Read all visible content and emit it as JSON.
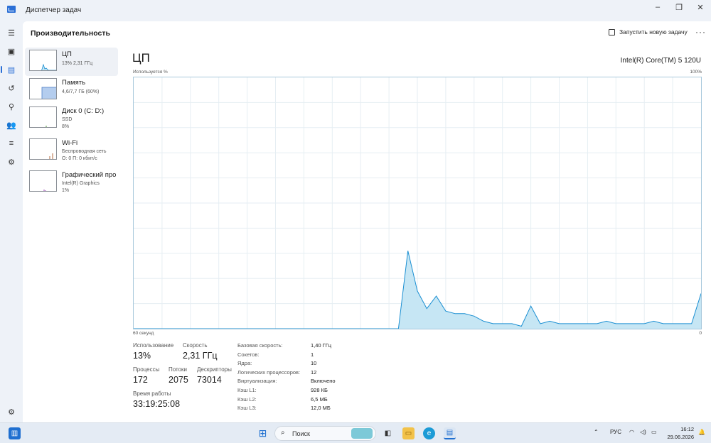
{
  "window": {
    "title": "Диспетчер задач"
  },
  "header": {
    "title": "Производительность",
    "new_task_label": "Запустить новую задачу"
  },
  "devices": [
    {
      "name": "ЦП",
      "sub1": "13% 2,31 ГГц",
      "sub2": "",
      "sub3": ""
    },
    {
      "name": "Память",
      "sub1": "4,6/7,7 ГБ (60%)",
      "sub2": "",
      "sub3": ""
    },
    {
      "name": "Диск 0 (C: D:)",
      "sub1": "SSD",
      "sub2": "8%",
      "sub3": ""
    },
    {
      "name": "Wi-Fi",
      "sub1": "Беспроводная сеть",
      "sub2": "О: 0 П: 0 кбит/с",
      "sub3": ""
    },
    {
      "name": "Графический про",
      "sub1": "Intel(R) Graphics",
      "sub2": "1%",
      "sub3": ""
    }
  ],
  "cpu": {
    "title": "ЦП",
    "model": "Intel(R) Core(TM) 5 120U",
    "y_label": "Используется %",
    "y_max_label": "100%",
    "x_left_label": "60 секунд",
    "x_right_label": "0"
  },
  "chart_data": {
    "type": "area",
    "title": "",
    "xlabel": "",
    "ylabel": "Используется %",
    "xlim": [
      60,
      0
    ],
    "ylim": [
      0,
      100
    ],
    "grid": true,
    "series": [
      {
        "name": "",
        "x": [
          60,
          59,
          58,
          57,
          56,
          55,
          54,
          53,
          52,
          51,
          50,
          49,
          48,
          47,
          46,
          45,
          44,
          43,
          42,
          41,
          40,
          39,
          38,
          37,
          36,
          35,
          34,
          33,
          32,
          31,
          30,
          29,
          28,
          27,
          26,
          25,
          24,
          23,
          22,
          21,
          20,
          19,
          18,
          17,
          16,
          15,
          14,
          13,
          12,
          11,
          10,
          9,
          8,
          7,
          6,
          5,
          4,
          3,
          2,
          1,
          0
        ],
        "values": [
          0,
          0,
          0,
          0,
          0,
          0,
          0,
          0,
          0,
          0,
          0,
          0,
          0,
          0,
          0,
          0,
          0,
          0,
          0,
          0,
          0,
          0,
          0,
          0,
          0,
          0,
          0,
          0,
          0,
          31,
          15,
          8,
          13,
          7,
          6,
          6,
          5,
          3,
          2,
          2,
          2,
          1,
          9,
          2,
          3,
          2,
          2,
          2,
          2,
          2,
          3,
          2,
          2,
          2,
          2,
          3,
          2,
          2,
          2,
          2,
          14
        ]
      }
    ]
  },
  "stats": {
    "usage_label": "Использование",
    "usage_value": "13%",
    "speed_label": "Скорость",
    "speed_value": "2,31 ГГц",
    "processes_label": "Процессы",
    "processes_value": "172",
    "threads_label": "Потоки",
    "threads_value": "2075",
    "handles_label": "Дескрипторы",
    "handles_value": "73014",
    "uptime_label": "Время работы",
    "uptime_value": "33:19:25:08"
  },
  "details": [
    {
      "key": "Базовая скорость:",
      "value": "1,40 ГГц"
    },
    {
      "key": "Сокетов:",
      "value": "1"
    },
    {
      "key": "Ядра:",
      "value": "10"
    },
    {
      "key": "Логических процессоров:",
      "value": "12"
    },
    {
      "key": "Виртуализация:",
      "value": "Включено"
    },
    {
      "key": "Кэш L1:",
      "value": "928 КБ"
    },
    {
      "key": "Кэш L2:",
      "value": "6,5 МБ"
    },
    {
      "key": "Кэш L3:",
      "value": "12,0 МБ"
    }
  ],
  "taskbar": {
    "search_placeholder": "Поиск",
    "language": "РУС",
    "time": "16:12",
    "date": "29.06.2026"
  },
  "colors": {
    "accent": "#2b6fd6",
    "cpu_line": "#1a8fd2",
    "cpu_fill": "#c6e6f4",
    "graph_border": "#a8c8dc"
  }
}
